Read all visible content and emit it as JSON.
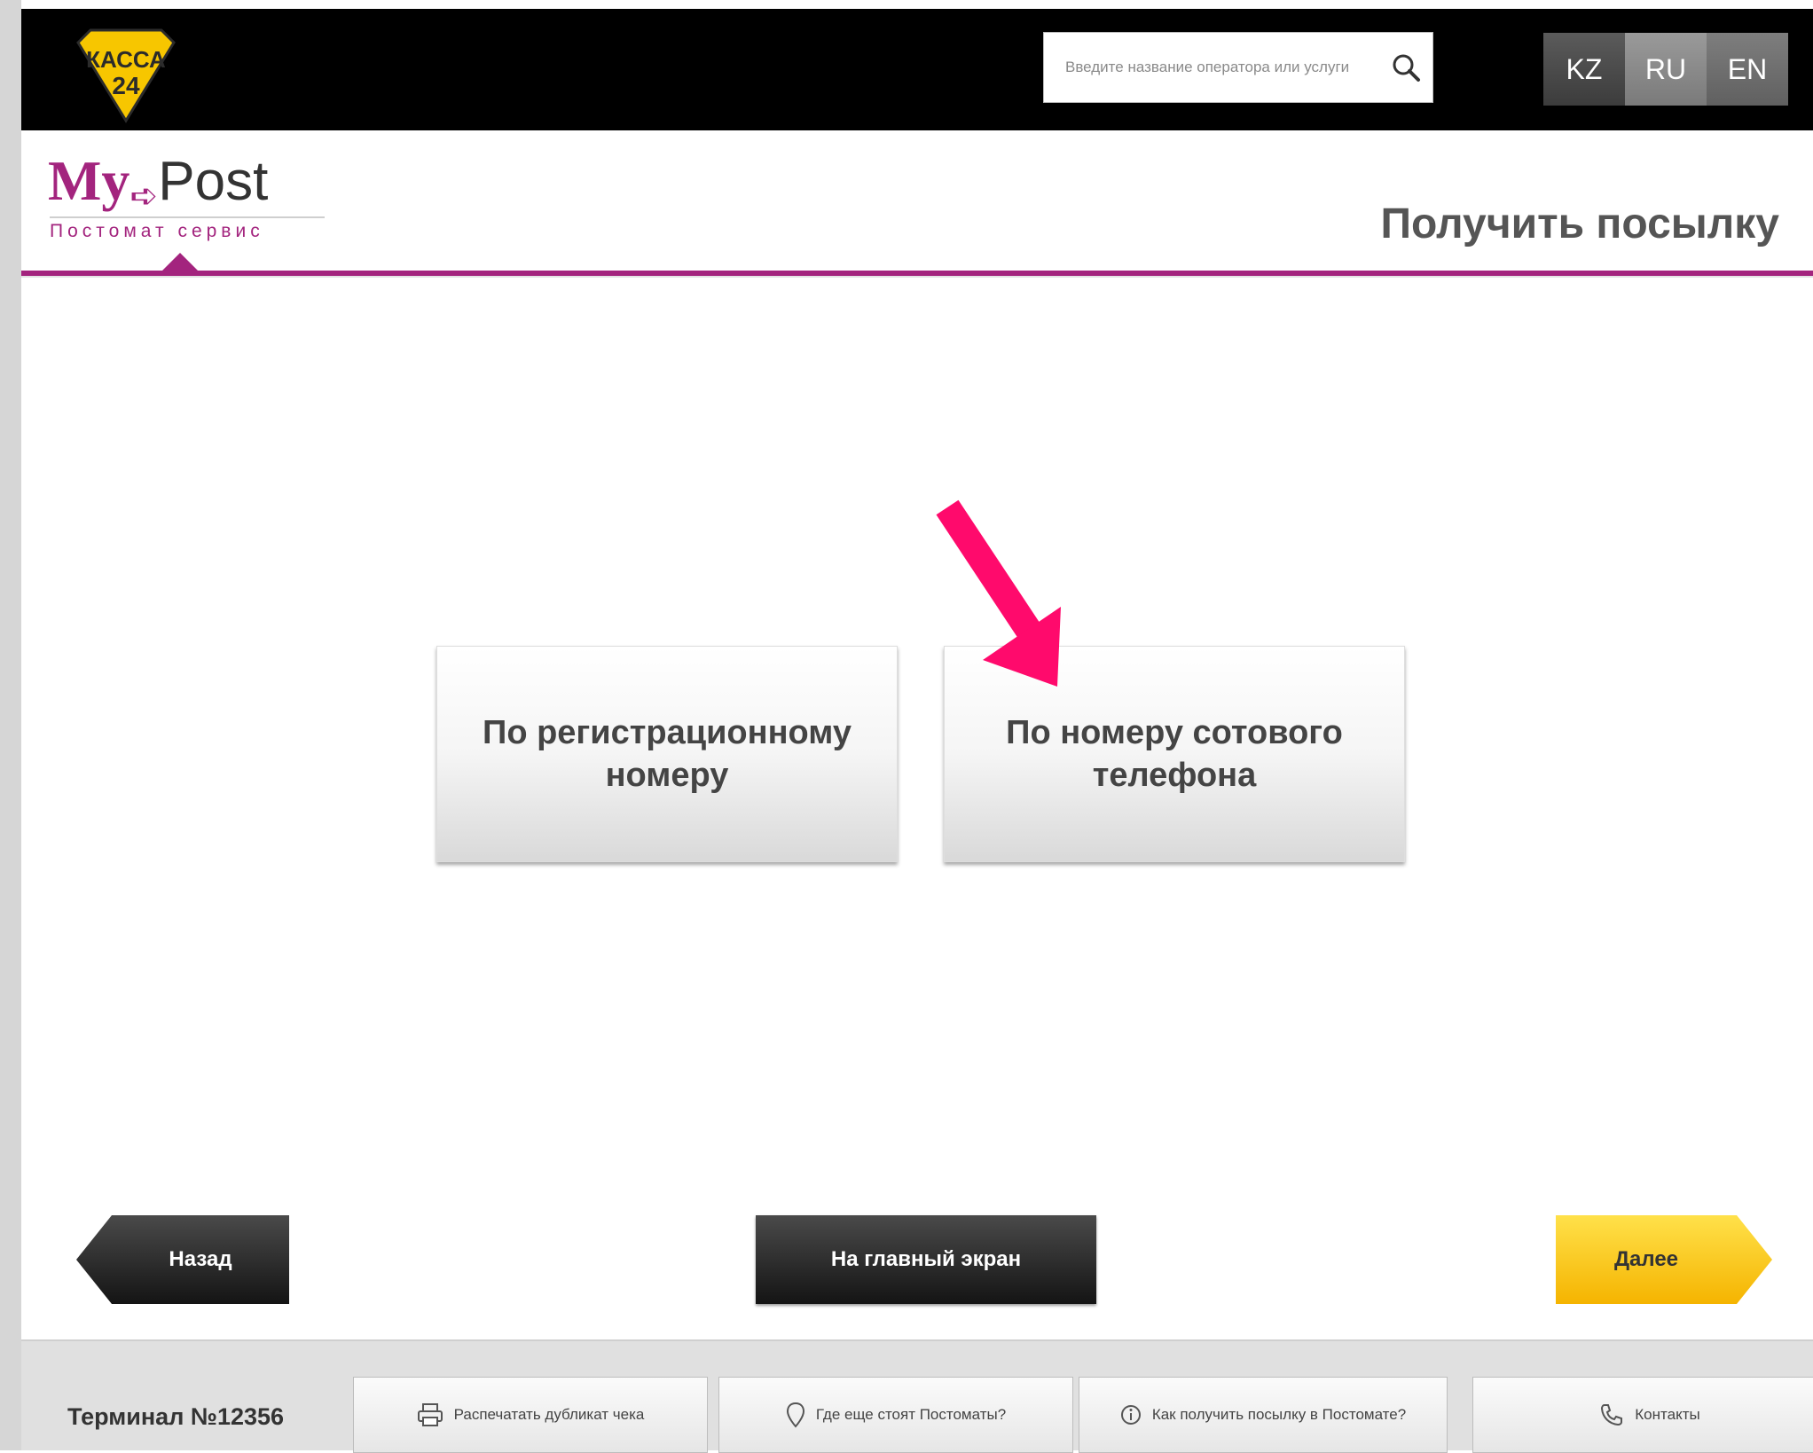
{
  "header": {
    "logo_text_top": "КАССА",
    "logo_text_bottom": "24",
    "search_placeholder": "Введите название оператора или услуги",
    "languages": [
      "KZ",
      "RU",
      "EN"
    ]
  },
  "brand": {
    "name_my": "My",
    "name_post": "Post",
    "subtitle": "Постомат сервис"
  },
  "page_title": "Получить посылку",
  "options": [
    "По регистрационному номеру",
    "По номеру сотового телефона"
  ],
  "nav": {
    "back": "Назад",
    "home": "На главный экран",
    "next": "Далее"
  },
  "footer": {
    "terminal": "Терминал №12356",
    "print_duplicate": "Распечатать дубликат чека",
    "where_postomats": "Где еще стоят Постоматы?",
    "how_receive": "Как получить посылку в Постомате?",
    "contacts": "Контакты"
  },
  "colors": {
    "brand_purple": "#a3247e",
    "kassa_yellow": "#f7c600",
    "pointer_pink": "#ff0a6c",
    "next_yellow": "#f5b400"
  }
}
